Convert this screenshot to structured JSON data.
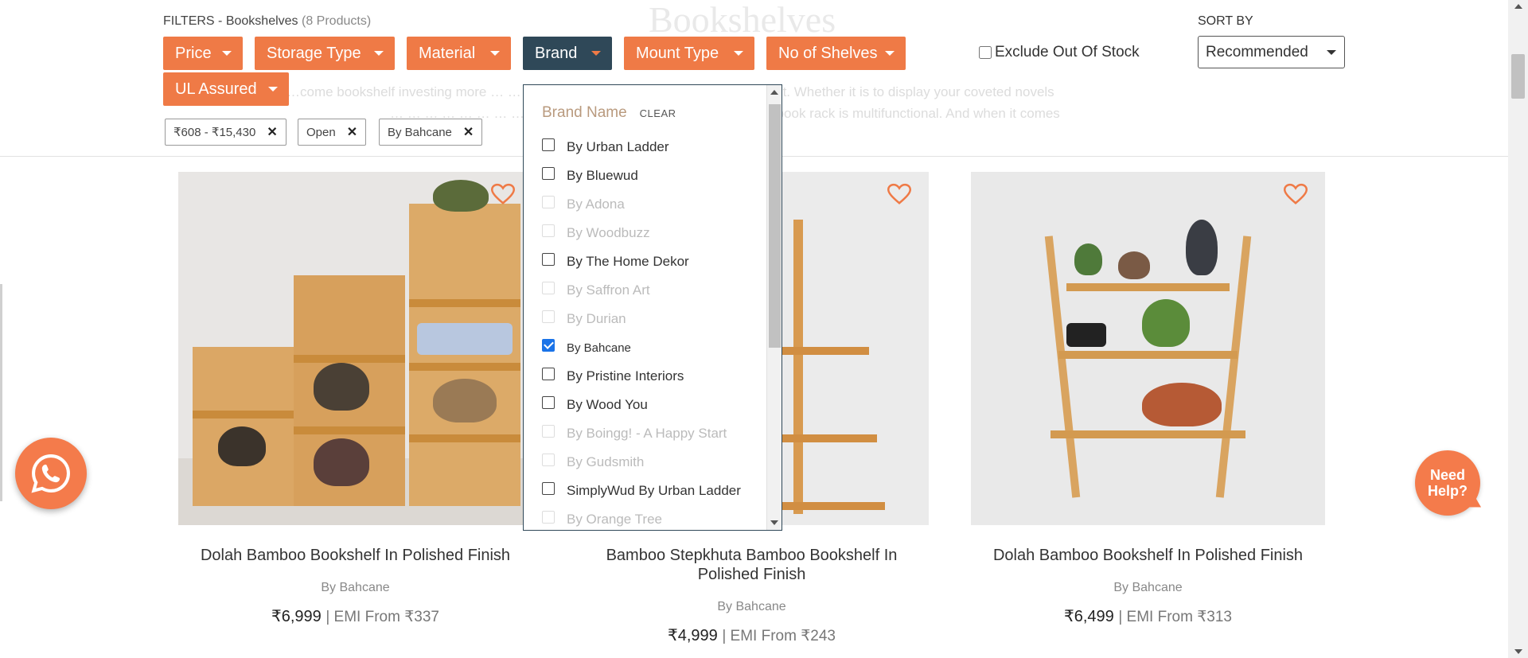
{
  "header": {
    "filters_label": "FILTERS - Bookshelves",
    "product_count": "(8 Products)",
    "bg_title": "Bookshelves",
    "bg_desc_line1": "…come bookshelf investing more … … … … … … … is probably a top requirement. Whether it is to display your coveted novels",
    "bg_desc_line2": "… … … … … … … … … … … …omes and other collectibles, a book rack is multifunctional. And when it comes"
  },
  "filters": [
    {
      "label": "Price",
      "active": false
    },
    {
      "label": "Storage Type",
      "active": false
    },
    {
      "label": "Material",
      "active": false
    },
    {
      "label": "Brand",
      "active": true
    },
    {
      "label": "Mount Type",
      "active": false
    },
    {
      "label": "No of Shelves",
      "active": false
    },
    {
      "label": "UL Assured",
      "active": false
    }
  ],
  "exclude_out_of_stock": {
    "label": "Exclude Out Of Stock",
    "checked": false
  },
  "sort": {
    "label": "SORT BY",
    "value": "Recommended"
  },
  "applied_chips": [
    "₹608 - ₹15,430",
    "Open",
    "By Bahcane"
  ],
  "chip_remove_glyph": "✕",
  "brand_dropdown": {
    "title": "Brand Name",
    "clear_label": "CLEAR",
    "items": [
      {
        "label": "By Urban Ladder",
        "state": "enabled"
      },
      {
        "label": "By Bluewud",
        "state": "enabled"
      },
      {
        "label": "By Adona",
        "state": "disabled"
      },
      {
        "label": "By Woodbuzz",
        "state": "disabled"
      },
      {
        "label": "By The Home Dekor",
        "state": "enabled"
      },
      {
        "label": "By Saffron Art",
        "state": "disabled"
      },
      {
        "label": "By Durian",
        "state": "disabled"
      },
      {
        "label": "By Bahcane",
        "state": "checked"
      },
      {
        "label": "By Pristine Interiors",
        "state": "enabled"
      },
      {
        "label": "By Wood You",
        "state": "enabled"
      },
      {
        "label": "By Boingg! - A Happy Start",
        "state": "disabled"
      },
      {
        "label": "By Gudsmith",
        "state": "disabled"
      },
      {
        "label": "SimplyWud By Urban Ladder",
        "state": "enabled"
      },
      {
        "label": "By Orange Tree",
        "state": "disabled"
      }
    ]
  },
  "products": [
    {
      "name": "Dolah Bamboo Bookshelf In Polished Finish",
      "brand": "By Bahcane",
      "price": "₹6,999",
      "emi": "| EMI From ₹337"
    },
    {
      "name": "Bamboo Stepkhuta Bamboo Bookshelf In Polished Finish",
      "brand": "By Bahcane",
      "price": "₹4,999",
      "emi": "| EMI From ₹243"
    },
    {
      "name": "Dolah Bamboo Bookshelf In Polished Finish",
      "brand": "By Bahcane",
      "price": "₹6,499",
      "emi": "| EMI From ₹313"
    }
  ],
  "help_button": {
    "line1": "Need",
    "line2": "Help?"
  },
  "colors": {
    "accent": "#ef7a46",
    "active_filter": "#2f4858",
    "checkbox_checked": "#1a73e8"
  },
  "icons": {
    "whatsapp": "whatsapp-icon",
    "wishlist": "heart-icon",
    "remove_chip": "close-icon",
    "dropdown_caret": "caret-down-icon"
  }
}
